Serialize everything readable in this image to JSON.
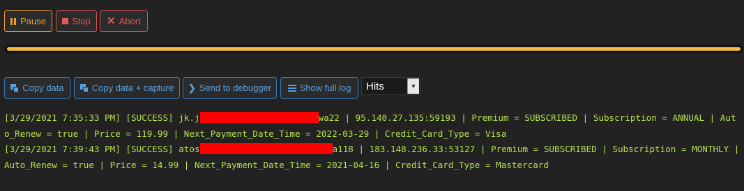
{
  "controls": {
    "pause_label": "Pause",
    "stop_label": "Stop",
    "abort_label": "Abort"
  },
  "progress": {
    "value": 1.0,
    "color": "#f5b942"
  },
  "toolbar": {
    "copy_data_label": "Copy data",
    "copy_data_capture_label": "Copy data + capture",
    "send_debugger_label": "Send to debugger",
    "show_full_log_label": "Show full log",
    "filter_selected": "Hits"
  },
  "log": {
    "entries": [
      {
        "prefix": "[3/29/2021 7:35:33 PM] [SUCCESS] jk.j",
        "suffix": "wa22 | 95.140.27.135:59193 | Premium = SUBSCRIBED | Subscription = ANNUAL | Auto_Renew = true | Price = 119.99 | Next_Payment_Date_Time = 2022-03-29 | Credit_Card_Type = Visa"
      },
      {
        "prefix": "[3/29/2021 7:39:43 PM] [SUCCESS] atos",
        "suffix": "a118 | 183.148.236.33:53127 | Premium = SUBSCRIBED | Subscription = MONTHLY | Auto_Renew = true | Price = 14.99 | Next_Payment_Date_Time = 2021-04-16 | Credit_Card_Type = Mastercard"
      }
    ]
  },
  "colors": {
    "background": "#222222",
    "log_text": "#b5e04a",
    "pause": "#f0a030",
    "danger": "#e05a55",
    "primary": "#5aa0e0",
    "redaction": "#ff0000"
  }
}
